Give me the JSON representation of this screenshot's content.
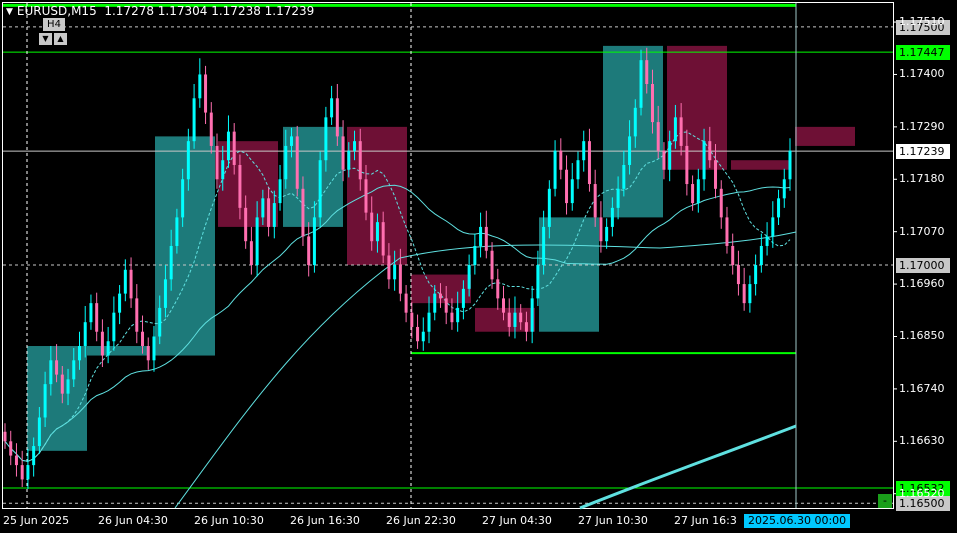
{
  "window": {
    "symbol_timeframe": "EURUSD,M15",
    "ohlc": "1.17278 1.17304 1.17238 1.17239",
    "overlay_timeframe": "H4",
    "tf_down_glyph": "▼",
    "tf_up_glyph": "▲",
    "minus_glyph": "-"
  },
  "colors": {
    "background": "#000000",
    "bull_candle": "#00ffff",
    "bear_candle": "#ff6fb0",
    "h4_bull_box": "#1d7a7a",
    "h4_bear_box": "#6e1035",
    "level_line": "#00ff00",
    "crosshair": "#ffffff",
    "ma_line": "#5fe0e0"
  },
  "price_axis": {
    "labels": [
      {
        "text": "1.17510",
        "value": 1.1751
      },
      {
        "text": "1.17400",
        "value": 1.174
      },
      {
        "text": "1.17290",
        "value": 1.1729
      },
      {
        "text": "1.17180",
        "value": 1.1718
      },
      {
        "text": "1.17070",
        "value": 1.1707
      },
      {
        "text": "1.16960",
        "value": 1.1696
      },
      {
        "text": "1.16850",
        "value": 1.1685
      },
      {
        "text": "1.16740",
        "value": 1.1674
      },
      {
        "text": "1.16630",
        "value": 1.1663
      },
      {
        "text": "1.16520",
        "value": 1.1652
      }
    ],
    "tags": [
      {
        "text": "1.17500",
        "value": 1.175,
        "bg": "#c8c8c8",
        "fg": "#000000"
      },
      {
        "text": "1.17447",
        "value": 1.17447,
        "bg": "#00ff00",
        "fg": "#000000"
      },
      {
        "text": "1.17239",
        "value": 1.17239,
        "bg": "#ffffff",
        "fg": "#000000"
      },
      {
        "text": "1.17000",
        "value": 1.17,
        "bg": "#c8c8c8",
        "fg": "#000000"
      },
      {
        "text": "1.16532",
        "value": 1.16532,
        "bg": "#00ff00",
        "fg": "#000000"
      },
      {
        "text": "1.16500",
        "value": 1.165,
        "bg": "#c8c8c8",
        "fg": "#000000"
      }
    ]
  },
  "time_axis": {
    "labels": [
      "25 Jun 2025",
      "26 Jun 04:30",
      "26 Jun 10:30",
      "26 Jun 16:30",
      "26 Jun 22:30",
      "27 Jun 04:30",
      "27 Jun 10:30",
      "27 Jun 16:3"
    ],
    "cursor_label": "2025.06.30 00:00"
  },
  "chart_data": {
    "type": "candlestick",
    "symbol": "EURUSD",
    "timeframe": "M15",
    "ylim": [
      1.1649,
      1.1755
    ],
    "levels": {
      "thick_top": 1.17545,
      "line_17447": 1.17447,
      "line_16532": 1.16532,
      "segment_low": 1.16815,
      "dashed_17500": 1.175,
      "dashed_17000": 1.17,
      "dashed_16500": 1.165,
      "current_price": 1.17239
    },
    "h4_boxes": [
      {
        "o": 1.1661,
        "c": 1.1683,
        "dir": "up"
      },
      {
        "o": 1.1681,
        "c": 1.1683,
        "dir": "up"
      },
      {
        "o": 1.1681,
        "c": 1.1727,
        "dir": "up"
      },
      {
        "o": 1.1726,
        "c": 1.1708,
        "dir": "down"
      },
      {
        "o": 1.1708,
        "c": 1.1729,
        "dir": "up"
      },
      {
        "o": 1.1729,
        "c": 1.17,
        "dir": "down"
      },
      {
        "o": 1.1698,
        "c": 1.1692,
        "dir": "down"
      },
      {
        "o": 1.1691,
        "c": 1.1686,
        "dir": "down"
      },
      {
        "o": 1.1686,
        "c": 1.171,
        "dir": "up"
      },
      {
        "o": 1.171,
        "c": 1.1746,
        "dir": "up"
      },
      {
        "o": 1.1746,
        "c": 1.172,
        "dir": "down"
      },
      {
        "o": 1.1722,
        "c": 1.172,
        "dir": "down"
      },
      {
        "o": 1.1729,
        "c": 1.1725,
        "dir": "down"
      }
    ],
    "closes_m15": [
      1.1663,
      1.166,
      1.1658,
      1.1655,
      1.1658,
      1.1662,
      1.1668,
      1.1675,
      1.168,
      1.1677,
      1.1673,
      1.1676,
      1.168,
      1.1683,
      1.1688,
      1.1692,
      1.1686,
      1.1681,
      1.1684,
      1.169,
      1.1694,
      1.1699,
      1.1693,
      1.1686,
      1.1683,
      1.168,
      1.1685,
      1.1691,
      1.1697,
      1.1704,
      1.171,
      1.1718,
      1.1726,
      1.1735,
      1.174,
      1.1732,
      1.1725,
      1.1718,
      1.1722,
      1.1728,
      1.1721,
      1.1712,
      1.1705,
      1.17,
      1.171,
      1.1714,
      1.1708,
      1.1713,
      1.1718,
      1.1725,
      1.1727,
      1.1716,
      1.1706,
      1.17,
      1.171,
      1.1722,
      1.1731,
      1.1735,
      1.1727,
      1.172,
      1.1724,
      1.1726,
      1.1718,
      1.1711,
      1.1705,
      1.1709,
      1.1702,
      1.1697,
      1.17,
      1.1694,
      1.169,
      1.1687,
      1.1684,
      1.1686,
      1.169,
      1.1694,
      1.1693,
      1.169,
      1.1688,
      1.1691,
      1.1695,
      1.17,
      1.1704,
      1.1708,
      1.1703,
      1.1697,
      1.1693,
      1.169,
      1.1687,
      1.169,
      1.1688,
      1.1686,
      1.1693,
      1.17,
      1.1708,
      1.1716,
      1.1724,
      1.172,
      1.1713,
      1.1718,
      1.1722,
      1.1726,
      1.1717,
      1.171,
      1.1705,
      1.1708,
      1.1712,
      1.1716,
      1.1721,
      1.1727,
      1.1733,
      1.1743,
      1.1738,
      1.173,
      1.1724,
      1.172,
      1.1726,
      1.1731,
      1.1725,
      1.1717,
      1.1713,
      1.1718,
      1.1726,
      1.1722,
      1.1716,
      1.171,
      1.1704,
      1.17,
      1.1696,
      1.1692,
      1.1696,
      1.17,
      1.1704,
      1.1706,
      1.171,
      1.1714,
      1.1718,
      1.1724
    ]
  }
}
